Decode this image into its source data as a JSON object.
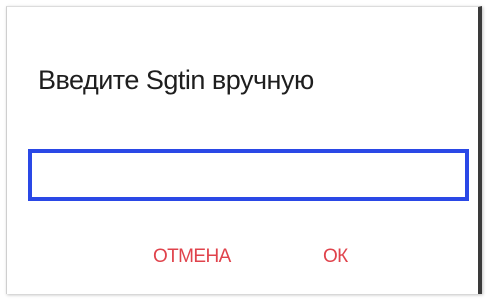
{
  "dialog": {
    "title": "Введите Sgtin вручную",
    "input": {
      "value": "",
      "placeholder": ""
    },
    "buttons": {
      "cancel_label": "ОТМЕНА",
      "ok_label": "ОК"
    },
    "colors": {
      "accent": "#e0434c",
      "input_border": "#2a48e6"
    }
  }
}
